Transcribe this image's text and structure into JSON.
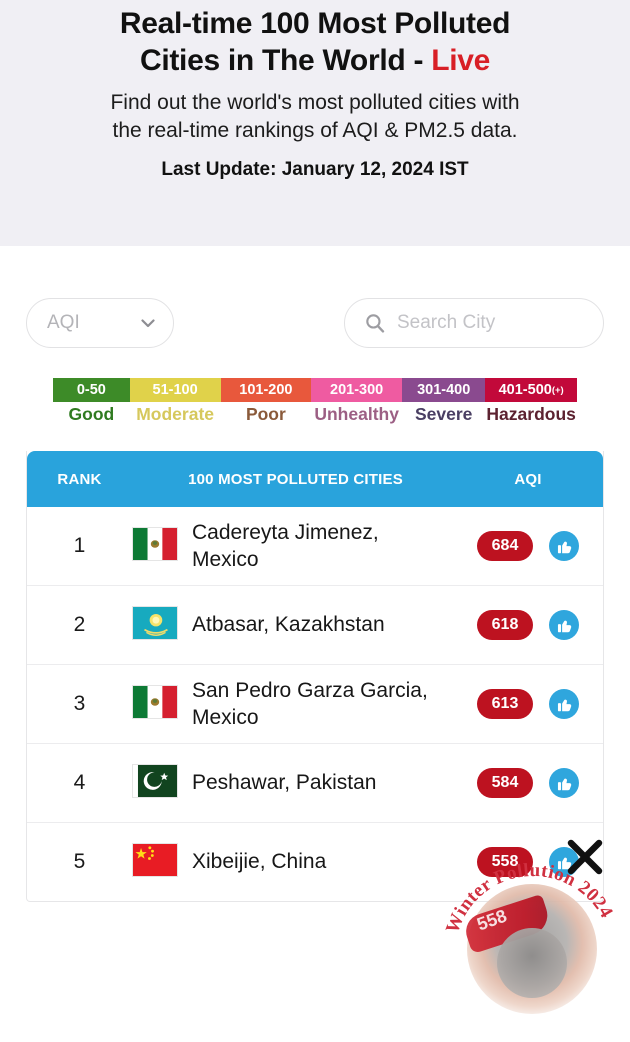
{
  "header": {
    "title_main": "Real-time 100 Most Cities in The World",
    "title_line1": "Real-time 100 Most Polluted",
    "title_line2": "Cities in The World",
    "title_dash": "-",
    "title_live": "Live",
    "subtitle_line1": "Find out the world's most polluted cities with",
    "subtitle_line2": "the real-time rankings of AQI & PM2.5 data.",
    "last_update": "Last Update: January 12, 2024 IST"
  },
  "controls": {
    "aqi_filter_value": "AQI",
    "aqi_filter_icon": "chevron-down-icon",
    "search_placeholder": "Search City",
    "search_value": "",
    "search_icon": "search-icon"
  },
  "legend": {
    "segments": [
      {
        "range": "0-50",
        "sup": "",
        "label": "Good",
        "color": "#3d8b28",
        "label_color": "#2f7a20"
      },
      {
        "range": "51-100",
        "sup": "",
        "label": "Moderate",
        "color": "#e0d24a",
        "label_color": "#d6c85c"
      },
      {
        "range": "101-200",
        "sup": "",
        "label": "Poor",
        "color": "#e8583c",
        "label_color": "#8a5a3a"
      },
      {
        "range": "201-300",
        "sup": "",
        "label": "Unhealthy",
        "color": "#ef5ba1",
        "label_color": "#9c5f84"
      },
      {
        "range": "301-400",
        "sup": "",
        "label": "Severe",
        "color": "#8a4a8f",
        "label_color": "#4a3f63"
      },
      {
        "range": "401-500",
        "sup": "(+)",
        "label": "Hazardous",
        "color": "#c2093a",
        "label_color": "#5c2230"
      }
    ]
  },
  "table": {
    "header_color": "#29a3dc",
    "columns": {
      "rank": "RANK",
      "city": "100 MOST POLLUTED CITIES",
      "aqi": "AQI"
    },
    "rows": [
      {
        "rank": "1",
        "city": "Cadereyta Jimenez, Mexico",
        "flag": "mexico-flag",
        "aqi": "684",
        "action_icon": "thumbs-up-icon"
      },
      {
        "rank": "2",
        "city": "Atbasar, Kazakhstan",
        "flag": "kazakhstan-flag",
        "aqi": "618",
        "action_icon": "thumbs-up-icon"
      },
      {
        "rank": "3",
        "city": "San Pedro Garza Garcia, Mexico",
        "flag": "mexico-flag",
        "aqi": "613",
        "action_icon": "thumbs-up-icon"
      },
      {
        "rank": "4",
        "city": "Peshawar, Pakistan",
        "flag": "pakistan-flag",
        "aqi": "584",
        "action_icon": "thumbs-up-icon"
      },
      {
        "rank": "5",
        "city": "Xibeijie, China",
        "flag": "china-flag",
        "aqi": "558",
        "action_icon": "thumbs-up-icon"
      }
    ]
  },
  "overlay": {
    "x_mark_icon": "close-x-icon",
    "watermark_text": "Winter Pollution 2024",
    "watermark_word1": "Winter Pollution",
    "watermark_word2": "2024"
  }
}
